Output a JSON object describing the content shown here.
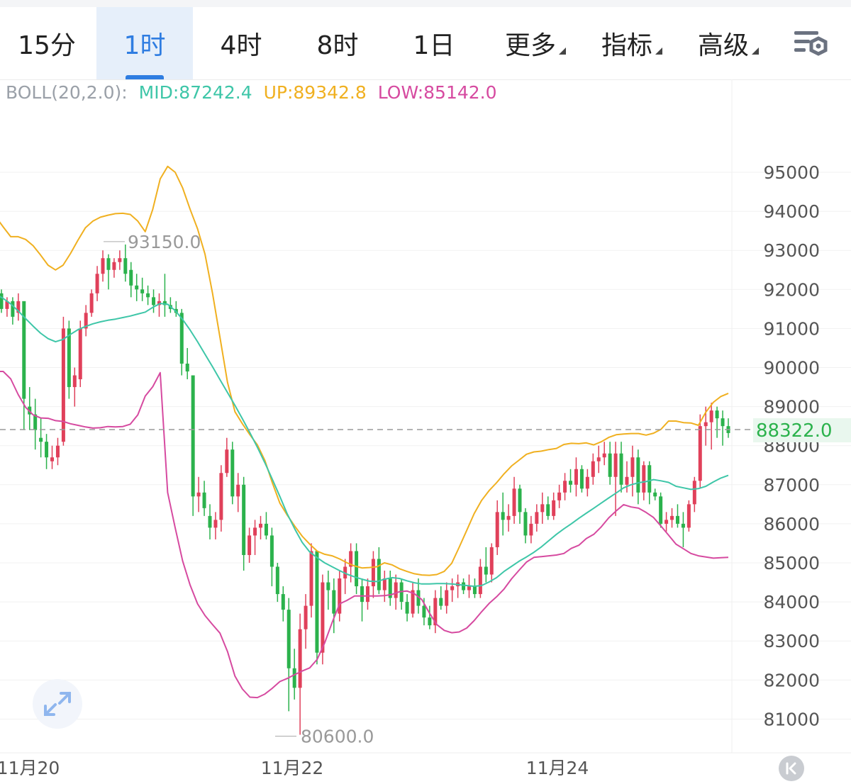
{
  "tabs": [
    {
      "label": "15分",
      "active": false,
      "dropdown": false
    },
    {
      "label": "1时",
      "active": true,
      "dropdown": false
    },
    {
      "label": "4时",
      "active": false,
      "dropdown": false
    },
    {
      "label": "8时",
      "active": false,
      "dropdown": false
    },
    {
      "label": "1日",
      "active": false,
      "dropdown": false
    },
    {
      "label": "更多",
      "active": false,
      "dropdown": true
    },
    {
      "label": "指标",
      "active": false,
      "dropdown": true
    },
    {
      "label": "高级",
      "active": false,
      "dropdown": true
    }
  ],
  "icons": {
    "settings": "settings-gear-icon",
    "expand": "expand-arrows-icon",
    "back": "jump-to-latest-icon"
  },
  "indicator": {
    "name": "BOLL(20,2.0):",
    "mid": "MID:87242.4",
    "up": "UP:89342.8",
    "low": "LOW:85142.0"
  },
  "colors": {
    "accent": "#2f7de1",
    "up_candle": "#e0405a",
    "down_candle": "#2bb24c",
    "mid": "#3ec6a8",
    "upper": "#f0b020",
    "lower": "#d64aa0",
    "current_price_bg": "#e9f7ee",
    "current_price_text": "#2bb24c"
  },
  "chart_data": {
    "type": "candlestick",
    "interval": "1时",
    "y_ticks": [
      95000,
      94000,
      93000,
      92000,
      91000,
      90000,
      89000,
      88000,
      87000,
      86000,
      85000,
      84000,
      83000,
      82000,
      81000
    ],
    "x_ticks": [
      "11月20",
      "11月22",
      "11月24"
    ],
    "current_price": "88322.0",
    "max_label": "93150.0",
    "min_label": "80600.0",
    "boll_mid": [
      91880,
      91770,
      91630,
      91450,
      91250,
      91060,
      90880,
      90740,
      90660,
      90720,
      90850,
      90970,
      91050,
      91120,
      91170,
      91210,
      91240,
      91280,
      91320,
      91370,
      91420,
      91540,
      91640,
      91620,
      91460,
      91230,
      90960,
      90660,
      90340,
      90020,
      89690,
      89360,
      89030,
      88690,
      88330,
      87960,
      87560,
      87140,
      86700,
      86250,
      85870,
      85520,
      85280,
      85130,
      85000,
      84900,
      84800,
      84710,
      84640,
      84580,
      84530,
      84520,
      84580,
      84620,
      84600,
      84540,
      84490,
      84460,
      84460,
      84470,
      84470,
      84460,
      84440,
      84420,
      84400,
      84420,
      84510,
      84620,
      84780,
      84910,
      85040,
      85150,
      85270,
      85410,
      85570,
      85730,
      85870,
      86000,
      86140,
      86270,
      86400,
      86530,
      86660,
      86790,
      86920,
      87000,
      87050,
      87080,
      87130,
      87100,
      87060,
      86960,
      86920,
      86880,
      86900,
      86960,
      87070,
      87170,
      87240
    ],
    "boll_upper": [
      93860,
      93600,
      93350,
      93350,
      93280,
      93120,
      92880,
      92620,
      92500,
      92620,
      92920,
      93260,
      93580,
      93750,
      93850,
      93900,
      93940,
      93950,
      93920,
      93750,
      93480,
      94050,
      94830,
      95150,
      95000,
      94600,
      94050,
      93550,
      92900,
      91900,
      90770,
      89620,
      88870,
      88560,
      88280,
      88020,
      87620,
      87050,
      86530,
      86220,
      85940,
      85680,
      85480,
      85300,
      85220,
      85180,
      85100,
      85000,
      84920,
      84870,
      84880,
      84900,
      85000,
      84950,
      84850,
      84780,
      84720,
      84690,
      84680,
      84700,
      84780,
      84990,
      85400,
      85830,
      86260,
      86600,
      86850,
      87050,
      87280,
      87480,
      87630,
      87780,
      87840,
      87860,
      87900,
      87930,
      88030,
      88060,
      88050,
      88070,
      88020,
      88100,
      88210,
      88280,
      88300,
      88310,
      88310,
      88270,
      88320,
      88420,
      88630,
      88630,
      88590,
      88580,
      88520,
      88860,
      89110,
      89260,
      89340
    ],
    "boll_lower": [
      89900,
      89900,
      89710,
      89310,
      88980,
      88790,
      88710,
      88700,
      88640,
      88620,
      88560,
      88520,
      88480,
      88450,
      88460,
      88490,
      88480,
      88490,
      88550,
      88790,
      89270,
      89510,
      89870,
      86800,
      85900,
      85050,
      84430,
      83950,
      83650,
      83420,
      83200,
      82730,
      82100,
      81770,
      81560,
      81550,
      81640,
      81790,
      81960,
      82040,
      82140,
      82230,
      82310,
      82530,
      82950,
      83470,
      83950,
      84040,
      84150,
      84150,
      84150,
      84150,
      84160,
      84190,
      84260,
      84280,
      84210,
      84060,
      83720,
      83420,
      83270,
      83210,
      83230,
      83330,
      83520,
      83750,
      83960,
      84130,
      84330,
      84590,
      84810,
      85020,
      85140,
      85160,
      85180,
      85200,
      85240,
      85370,
      85450,
      85620,
      85730,
      85920,
      86150,
      86330,
      86490,
      86430,
      86400,
      86290,
      86160,
      85940,
      85710,
      85480,
      85360,
      85240,
      85180,
      85150,
      85120,
      85130,
      85140
    ],
    "candles": [
      [
        91900,
        92000,
        91400,
        91500
      ],
      [
        91500,
        91800,
        91300,
        91700
      ],
      [
        91700,
        91800,
        91100,
        91300
      ],
      [
        91400,
        91900,
        91200,
        91700
      ],
      [
        91700,
        91600,
        88400,
        89200
      ],
      [
        89000,
        89500,
        88400,
        88800
      ],
      [
        88800,
        89200,
        87900,
        88400
      ],
      [
        88200,
        88700,
        87700,
        88100
      ],
      [
        88100,
        88300,
        87400,
        87700
      ],
      [
        87600,
        88000,
        87400,
        87700
      ],
      [
        87700,
        88200,
        87500,
        88000
      ],
      [
        88100,
        91300,
        88000,
        91000
      ],
      [
        91000,
        91200,
        89200,
        89500
      ],
      [
        89500,
        90000,
        89000,
        89800
      ],
      [
        89700,
        91200,
        89500,
        91000
      ],
      [
        91000,
        91600,
        90800,
        91400
      ],
      [
        91400,
        92000,
        91300,
        91900
      ],
      [
        91900,
        92600,
        91700,
        92400
      ],
      [
        92400,
        93000,
        92200,
        92800
      ],
      [
        92800,
        92900,
        92000,
        92500
      ],
      [
        92500,
        92800,
        92300,
        92700
      ],
      [
        92700,
        93000,
        92500,
        92800
      ],
      [
        92800,
        93150,
        92200,
        92400
      ],
      [
        92500,
        92700,
        91800,
        92100
      ],
      [
        92100,
        92400,
        91700,
        92000
      ],
      [
        92000,
        92300,
        91700,
        91900
      ],
      [
        91900,
        92100,
        91600,
        91800
      ],
      [
        91800,
        92000,
        91400,
        91600
      ],
      [
        91600,
        91900,
        91300,
        91700
      ],
      [
        91700,
        92400,
        91300,
        91600
      ],
      [
        91600,
        91800,
        91400,
        91500
      ],
      [
        91500,
        91700,
        91300,
        91400
      ],
      [
        91400,
        91500,
        89800,
        90100
      ],
      [
        90100,
        90500,
        89700,
        89900
      ],
      [
        89800,
        88000,
        86200,
        86700
      ],
      [
        86700,
        87200,
        86300,
        86800
      ],
      [
        86800,
        87100,
        86200,
        86400
      ],
      [
        86200,
        86500,
        85600,
        85900
      ],
      [
        85900,
        86300,
        85600,
        86100
      ],
      [
        86100,
        87500,
        85800,
        87300
      ],
      [
        87300,
        88200,
        87200,
        87900
      ],
      [
        87900,
        88100,
        86500,
        86700
      ],
      [
        86700,
        87300,
        86300,
        87000
      ],
      [
        87000,
        87200,
        84800,
        85200
      ],
      [
        85200,
        85900,
        85000,
        85700
      ],
      [
        85700,
        86100,
        85200,
        85900
      ],
      [
        85900,
        86200,
        85600,
        86000
      ],
      [
        86000,
        86300,
        85600,
        85700
      ],
      [
        85700,
        85900,
        84400,
        84900
      ],
      [
        84900,
        85000,
        84000,
        84200
      ],
      [
        84200,
        84400,
        83500,
        83800
      ],
      [
        83800,
        84100,
        81200,
        82300
      ],
      [
        82300,
        82800,
        81500,
        81800
      ],
      [
        81800,
        83700,
        80600,
        83300
      ],
      [
        83300,
        84200,
        82800,
        83900
      ],
      [
        83900,
        85500,
        83600,
        85300
      ],
      [
        85300,
        85200,
        82400,
        82700
      ],
      [
        82700,
        84700,
        82400,
        84500
      ],
      [
        84500,
        84800,
        83800,
        84300
      ],
      [
        84300,
        84600,
        83200,
        83700
      ],
      [
        83700,
        84800,
        83500,
        84600
      ],
      [
        84600,
        85100,
        84200,
        84900
      ],
      [
        84900,
        85500,
        84500,
        85300
      ],
      [
        85300,
        85500,
        84200,
        84400
      ],
      [
        84400,
        84600,
        83500,
        84000
      ],
      [
        84000,
        84600,
        83800,
        84400
      ],
      [
        84400,
        85300,
        84100,
        85100
      ],
      [
        85100,
        85400,
        84200,
        84300
      ],
      [
        84300,
        84800,
        84000,
        84600
      ],
      [
        84600,
        84800,
        83900,
        84100
      ],
      [
        84100,
        84700,
        83800,
        84500
      ],
      [
        84500,
        84600,
        83800,
        84000
      ],
      [
        84000,
        84200,
        83500,
        83700
      ],
      [
        83700,
        84500,
        83600,
        84300
      ],
      [
        84300,
        84600,
        83700,
        83900
      ],
      [
        83900,
        84100,
        83400,
        83600
      ],
      [
        83600,
        83900,
        83300,
        83400
      ],
      [
        83400,
        84300,
        83200,
        84100
      ],
      [
        84100,
        84400,
        83800,
        83900
      ],
      [
        83900,
        84500,
        83700,
        84300
      ],
      [
        84300,
        84600,
        84000,
        84400
      ],
      [
        84400,
        84700,
        84100,
        84500
      ],
      [
        84500,
        84600,
        84200,
        84300
      ],
      [
        84300,
        84700,
        84100,
        84400
      ],
      [
        84400,
        84600,
        84100,
        84200
      ],
      [
        84200,
        85100,
        84100,
        84900
      ],
      [
        84900,
        85400,
        84500,
        84700
      ],
      [
        84700,
        85500,
        84500,
        85400
      ],
      [
        85400,
        86600,
        85200,
        86300
      ],
      [
        86300,
        86800,
        85700,
        86100
      ],
      [
        86100,
        86500,
        85800,
        86200
      ],
      [
        86200,
        87200,
        86000,
        86900
      ],
      [
        86900,
        87000,
        86000,
        86300
      ],
      [
        86300,
        86400,
        85500,
        85700
      ],
      [
        85700,
        86200,
        85500,
        86000
      ],
      [
        86000,
        86500,
        85800,
        86300
      ],
      [
        86300,
        86800,
        86000,
        86500
      ],
      [
        86500,
        86700,
        86100,
        86200
      ],
      [
        86200,
        86800,
        86100,
        86600
      ],
      [
        86600,
        87000,
        86400,
        86800
      ],
      [
        86800,
        87300,
        86600,
        87100
      ],
      [
        87100,
        87400,
        86800,
        87000
      ],
      [
        87000,
        87700,
        86700,
        87400
      ],
      [
        87400,
        87500,
        86800,
        86900
      ],
      [
        86900,
        87400,
        86700,
        87200
      ],
      [
        87200,
        87800,
        87000,
        87600
      ],
      [
        87600,
        88000,
        87300,
        87700
      ],
      [
        87700,
        88100,
        87500,
        87800
      ],
      [
        87800,
        88100,
        87000,
        87200
      ],
      [
        87200,
        88100,
        86200,
        87800
      ],
      [
        87800,
        88100,
        86800,
        87000
      ],
      [
        87000,
        87600,
        86800,
        87200
      ],
      [
        87200,
        88000,
        86700,
        87700
      ],
      [
        87700,
        87900,
        86500,
        86800
      ],
      [
        86800,
        87600,
        86600,
        87500
      ],
      [
        87500,
        87600,
        86500,
        86800
      ],
      [
        86800,
        86900,
        86600,
        86700
      ],
      [
        86700,
        86800,
        85900,
        86000
      ],
      [
        86000,
        86300,
        85800,
        86100
      ],
      [
        86100,
        86400,
        85900,
        86200
      ],
      [
        86200,
        86500,
        85900,
        86000
      ],
      [
        86000,
        86300,
        85400,
        85900
      ],
      [
        85900,
        86600,
        85800,
        86500
      ],
      [
        86500,
        87200,
        86300,
        87100
      ],
      [
        87100,
        88800,
        86900,
        88500
      ],
      [
        88500,
        89000,
        88000,
        88600
      ],
      [
        88600,
        89100,
        87900,
        88900
      ],
      [
        88900,
        89000,
        88200,
        88700
      ],
      [
        88700,
        88900,
        88000,
        88500
      ],
      [
        88500,
        88700,
        88200,
        88322
      ]
    ]
  }
}
